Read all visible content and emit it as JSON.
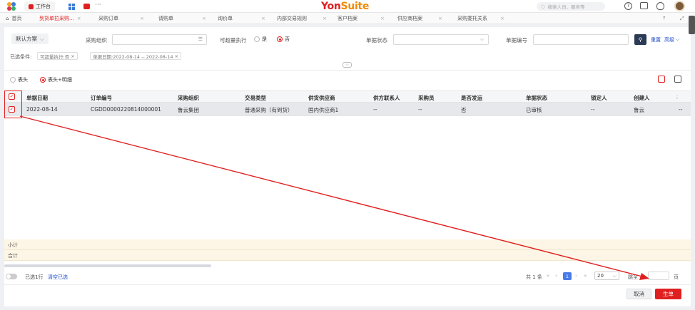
{
  "topbar": {
    "workbench": "工作台",
    "more": "···",
    "logo_a": "Yon",
    "logo_b": "Suite",
    "search_placeholder": "搜索人员、服务等"
  },
  "tabs": {
    "home": "首页",
    "items": [
      {
        "label": "到货单拉采购..."
      },
      {
        "label": "采购订单"
      },
      {
        "label": "请购单"
      },
      {
        "label": "询价单"
      },
      {
        "label": "内部交易规则"
      },
      {
        "label": "客户档案"
      },
      {
        "label": "供应商档案"
      },
      {
        "label": "采购委托关系"
      }
    ]
  },
  "filters": {
    "scheme": "默认方案",
    "org_label": "采购组织",
    "over_label": "可超量执行",
    "yes": "是",
    "no": "否",
    "status_label": "单据状态",
    "code_label": "单据编号",
    "reset": "重置",
    "advanced": "高级",
    "selected_label": "已选条件:",
    "chip1": "可超量执行:否",
    "chip2": "单据日期:2022-08-14 -- 2022-08-14"
  },
  "view": {
    "header_only": "表头",
    "header_detail": "表头+明细"
  },
  "table": {
    "columns": [
      "单据日期",
      "订单编号",
      "采购组织",
      "交易类型",
      "供货供应商",
      "供方联系人",
      "采购员",
      "是否发运",
      "单据状态",
      "锁定人",
      "创建人"
    ],
    "rows": [
      [
        "2022-08-14",
        "CGDD0000220814000001",
        "鲁云集团",
        "普通采购（有到货）",
        "国内供应商1",
        "--",
        "--",
        "否",
        "已审核",
        "--",
        "鲁云",
        "--"
      ]
    ]
  },
  "summary": {
    "subtotal": "小计",
    "total": "合计"
  },
  "footer": {
    "selected_count": "已选1行",
    "clear": "清空已选",
    "total": "共 1 条",
    "current_page": "1",
    "page_size": "20",
    "goto_label": "跳至",
    "page_unit": "页",
    "cancel": "取消",
    "generate": "生单"
  },
  "colors": {
    "accent": "#e02020",
    "primary": "#1e4bc8"
  }
}
